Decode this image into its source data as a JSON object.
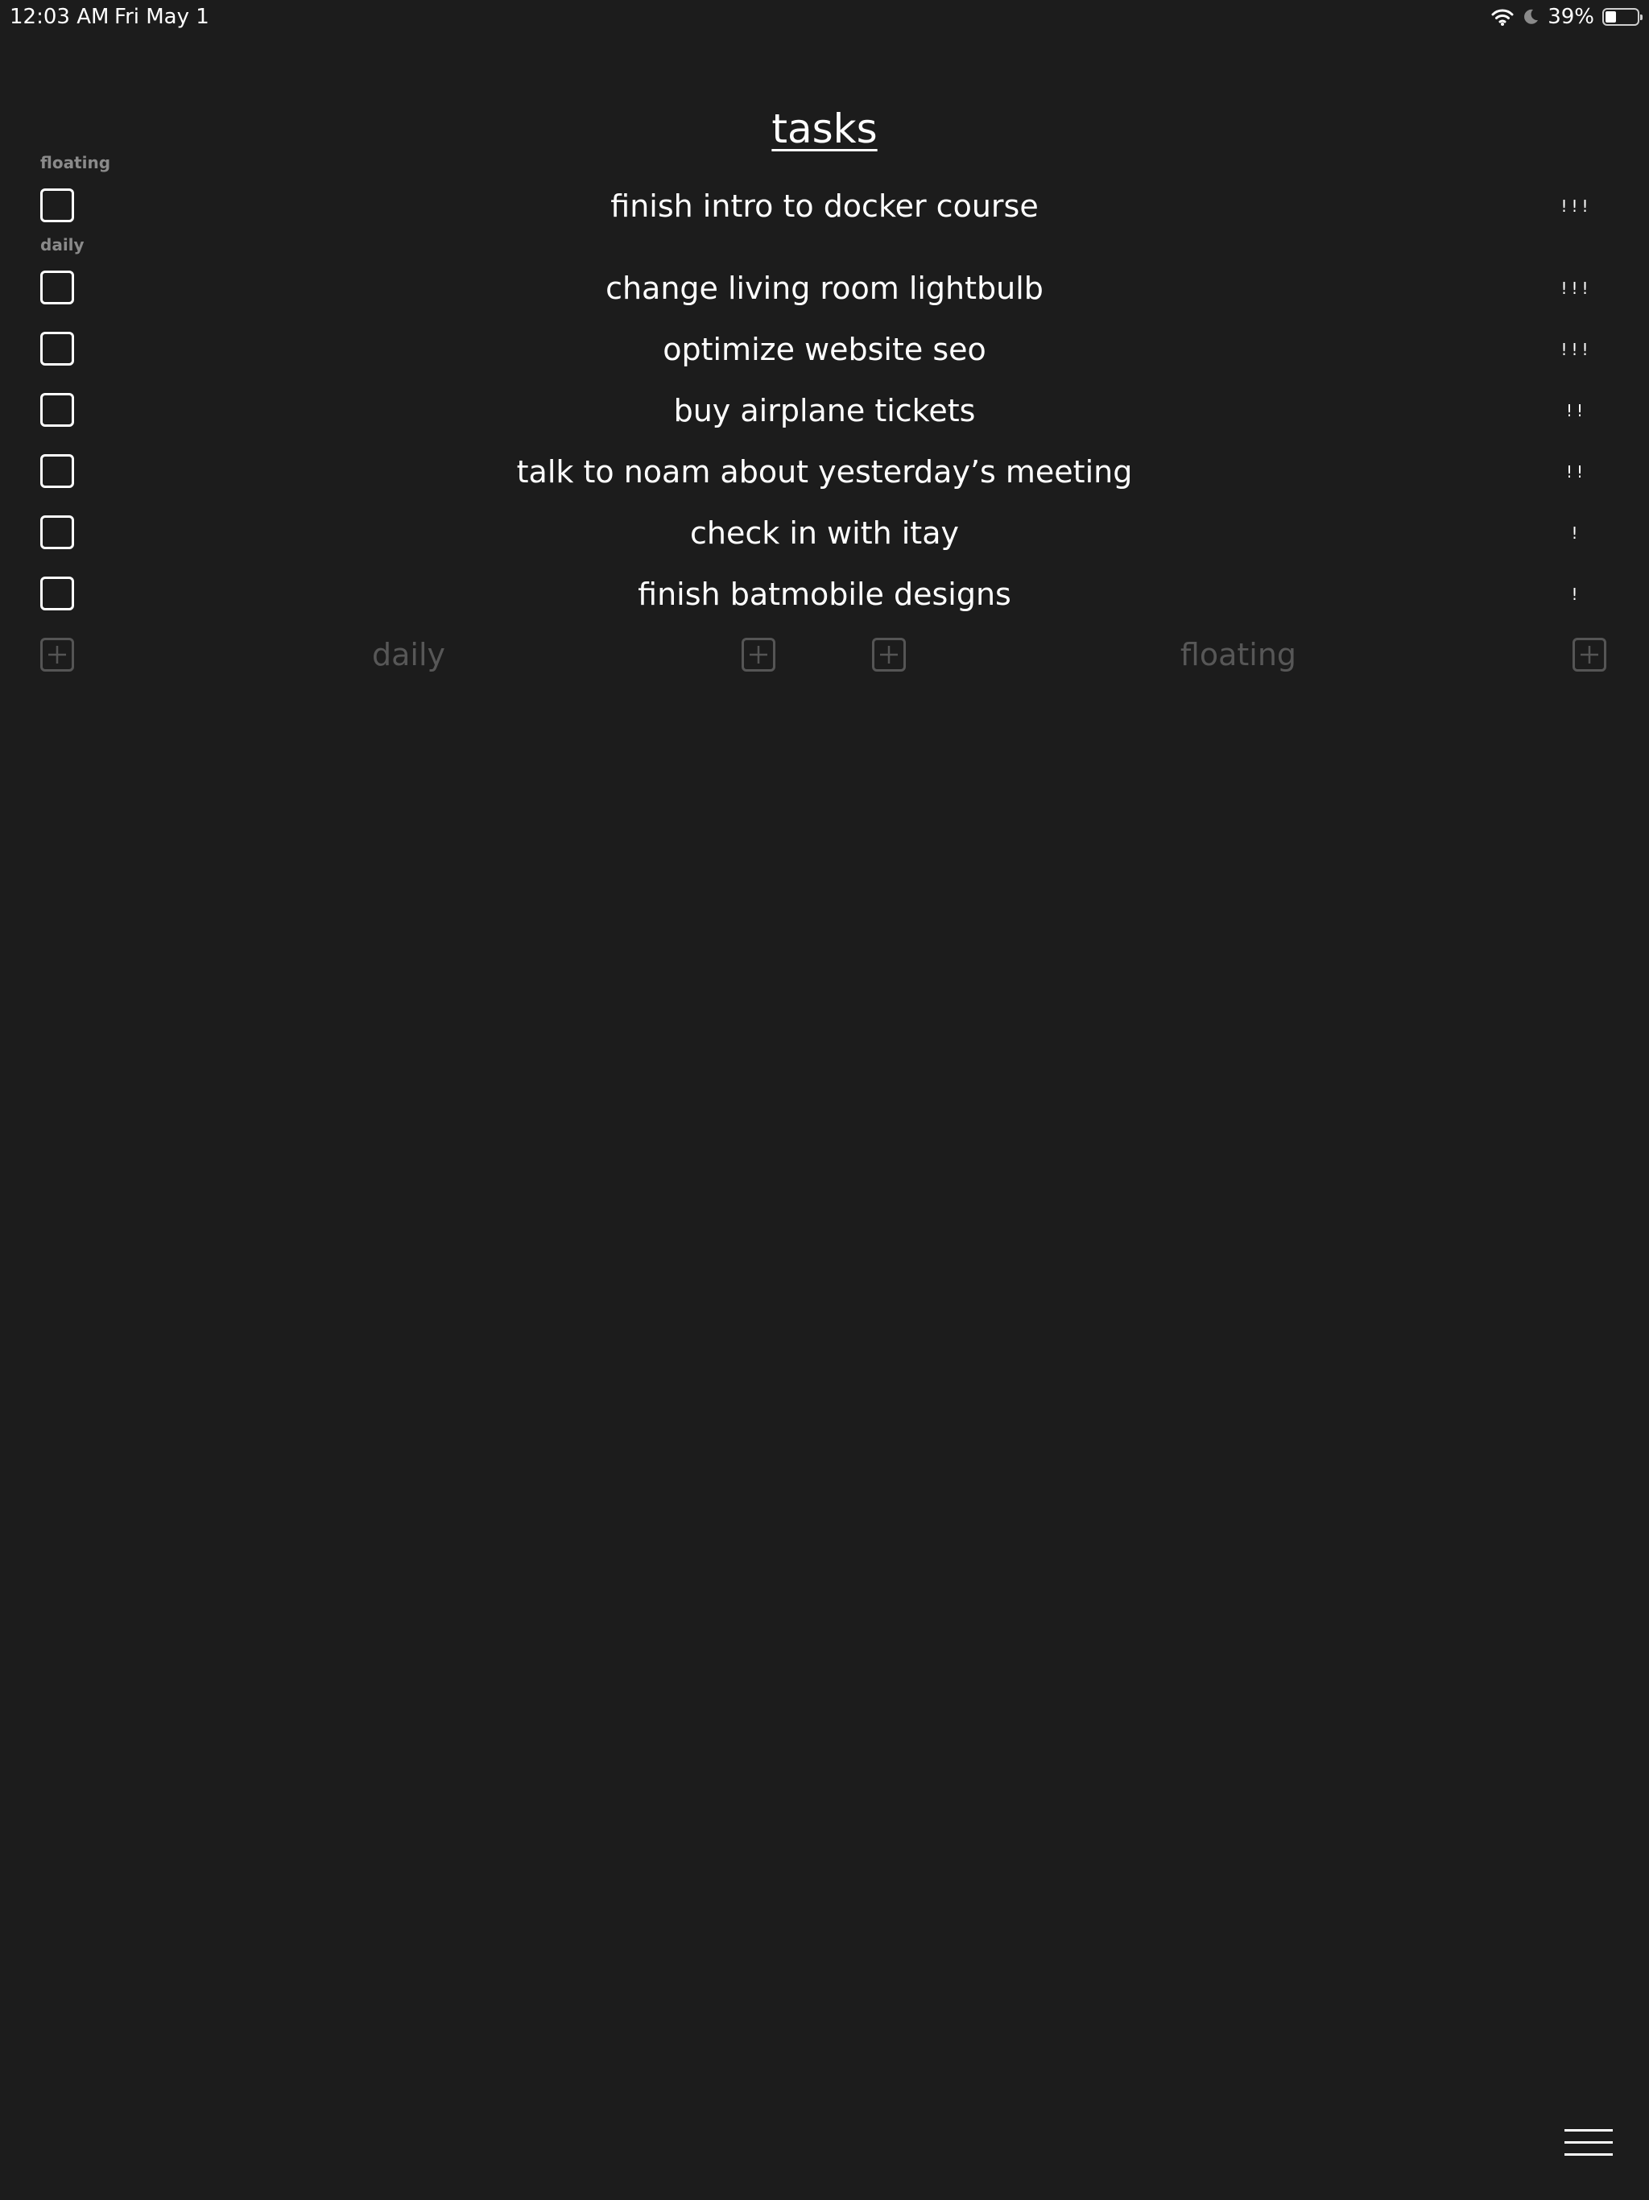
{
  "status_bar": {
    "time": "12:03 AM",
    "date": "Fri May 1",
    "battery": "39%",
    "icons": [
      "wifi-icon",
      "moon-icon",
      "battery-icon"
    ]
  },
  "title": "tasks",
  "sections": {
    "floating_label": "floating",
    "daily_label": "daily"
  },
  "floating_tasks": [
    {
      "text": "finish intro to docker course",
      "priority": "!!!"
    }
  ],
  "daily_tasks": [
    {
      "text": "change living room lightbulb",
      "priority": "!!!"
    },
    {
      "text": "optimize website seo",
      "priority": "!!!"
    },
    {
      "text": "buy airplane tickets",
      "priority": "!!"
    },
    {
      "text": "talk to noam about yesterday’s meeting",
      "priority": "!!"
    },
    {
      "text": "check in with itay",
      "priority": "!"
    },
    {
      "text": "finish batmobile designs",
      "priority": "!"
    }
  ],
  "add_bars": {
    "daily_label": "daily",
    "floating_label": "floating"
  },
  "colors": {
    "background": "#1c1c1c",
    "text": "#ffffff",
    "muted": "#575757",
    "section_label": "#8a8a8a"
  }
}
